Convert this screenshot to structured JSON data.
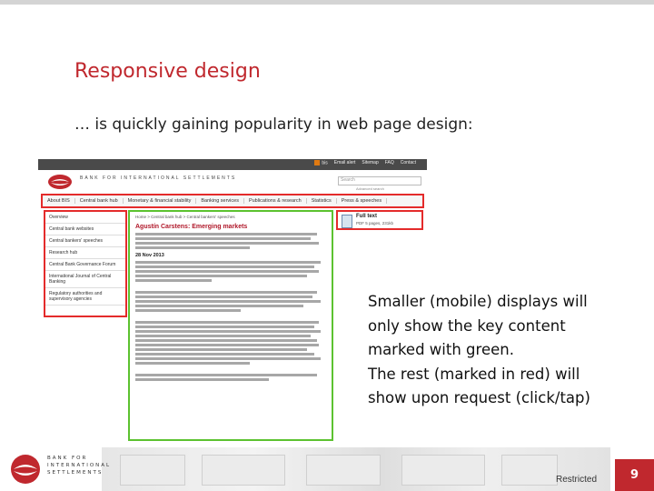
{
  "slide": {
    "title": "Responsive design",
    "subtitle": "… is quickly gaining popularity in web page design:",
    "callout": [
      "Smaller (mobile) displays will",
      "only show the key content",
      "marked with green.",
      "The rest (marked in red) will",
      "show upon request (click/tap)"
    ],
    "classification": "Restricted",
    "page_number": "9"
  },
  "website": {
    "top_links": [
      "bis",
      "Email alert",
      "Sitemap",
      "FAQ",
      "Contact"
    ],
    "org_name_line1": "BANK FOR INTERNATIONAL SETTLEMENTS",
    "search_placeholder": "Search",
    "advanced_search": "Advanced search",
    "nav": [
      "About BIS",
      "Central bank hub",
      "Monetary & financial stability",
      "Banking services",
      "Publications & research",
      "Statistics",
      "Press & speeches"
    ],
    "sidebar": [
      "Overview",
      "Central bank websites",
      "Central bankers' speeches",
      "Research hub",
      "Central Bank Governance Forum",
      "International Journal of Central Banking",
      "Regulatory authorities and supervisory agencies"
    ],
    "breadcrumb": "Home > Central bank hub > Central bankers' speeches",
    "speech_title": "Agustín Carstens: Emerging markets",
    "speech_date": "28 Nov 2013",
    "full_text_label": "Full text",
    "full_text_sub": "PDF 5 pages, 231kb"
  },
  "footer": {
    "org_name": [
      "BANK FOR",
      "INTERNATIONAL",
      "SETTLEMENTS"
    ]
  },
  "colors": {
    "accent_red": "#c0282e",
    "highlight_red": "#e42b2b",
    "highlight_green": "#5cc230"
  },
  "icons": {
    "bis_logo": "bis-logo-icon",
    "pdf": "pdf-document-icon"
  }
}
